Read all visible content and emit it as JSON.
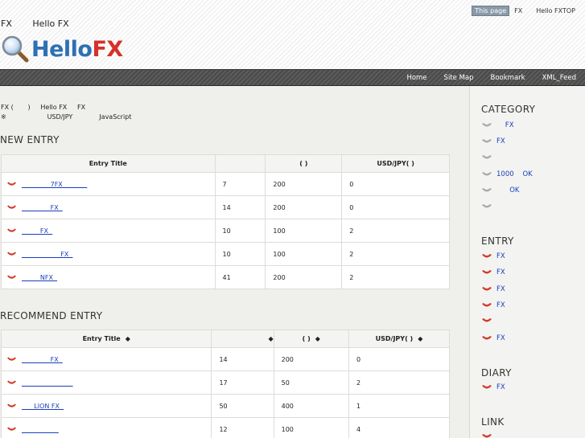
{
  "header": {
    "this_page": "This page",
    "top_links": [
      "FX",
      "Hello FXTOP"
    ],
    "tagline": [
      "FX",
      "Hello FX"
    ],
    "logo_hello": "Hello",
    "logo_fx": "FX"
  },
  "nav": [
    "Home",
    "Site Map",
    "Bookmark",
    "XML_Feed"
  ],
  "intro": {
    "line1": "FX (       )     Hello FX     FX",
    "line2": "※                    USD/JPY             JavaScript"
  },
  "new_entry": {
    "title": "NEW ENTRY",
    "headers": [
      "Entry Title",
      "",
      "(  )",
      "USD/JPY(  )"
    ],
    "rows": [
      {
        "title": "              7FX            ",
        "c1": "7",
        "c2": "200",
        "c3": "0"
      },
      {
        "title": "              FX  ",
        "c1": "14",
        "c2": "200",
        "c3": "0"
      },
      {
        "title": "         FX  ",
        "c1": "10",
        "c2": "100",
        "c3": "2"
      },
      {
        "title": "                   FX  ",
        "c1": "10",
        "c2": "100",
        "c3": "2"
      },
      {
        "title": "         NFX  ",
        "c1": "41",
        "c2": "200",
        "c3": "2"
      }
    ]
  },
  "recommend_entry": {
    "title": "RECOMMEND ENTRY",
    "headers": [
      "Entry Title",
      "",
      "(  )",
      "USD/JPY(  )"
    ],
    "rows": [
      {
        "title": "              FX  ",
        "c1": "14",
        "c2": "200",
        "c3": "0"
      },
      {
        "title": "                         ",
        "c1": "17",
        "c2": "50",
        "c3": "2"
      },
      {
        "title": "      LION FX  ",
        "c1": "50",
        "c2": "400",
        "c3": "1"
      },
      {
        "title": "                  ",
        "c1": "12",
        "c2": "100",
        "c3": "4"
      }
    ]
  },
  "sidebar": {
    "category_title": "CATEGORY",
    "categories": [
      "    FX",
      "FX",
      "",
      "1000    OK",
      "      OK",
      ""
    ],
    "entry_title": "ENTRY",
    "entries": [
      "FX",
      "FX",
      "FX",
      "FX",
      "",
      "FX"
    ],
    "diary_title": "DIARY",
    "diary": [
      "FX"
    ],
    "link_title": "LINK"
  },
  "colors": {
    "accent_blue": "#2f6fb3",
    "accent_red": "#d5312a",
    "link": "#1a3fbb"
  }
}
